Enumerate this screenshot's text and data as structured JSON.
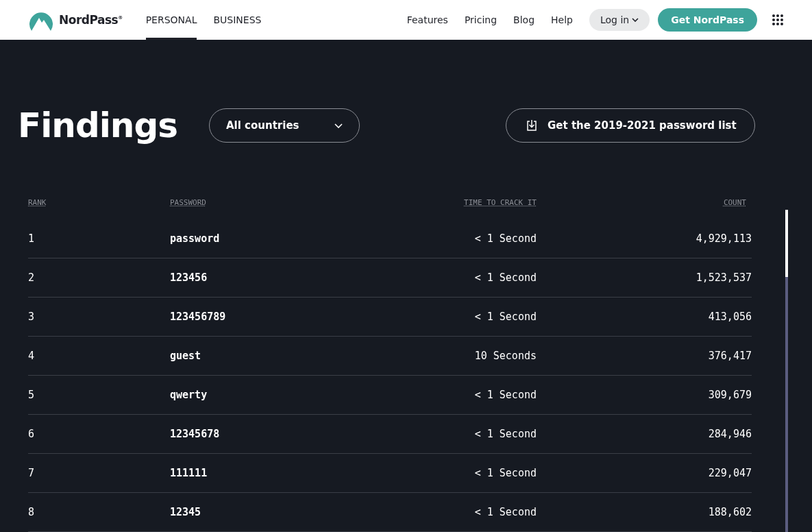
{
  "nav": {
    "brand": "NordPass",
    "brand_mark": "®",
    "tabs": [
      {
        "label": "PERSONAL",
        "selected": true
      },
      {
        "label": "BUSINESS",
        "selected": false
      }
    ],
    "links": [
      "Features",
      "Pricing",
      "Blog",
      "Help"
    ],
    "login": "Log in",
    "cta": "Get NordPass"
  },
  "heading": "Findings",
  "country_select": {
    "value": "All countries"
  },
  "download": "Get the 2019-2021 password list",
  "table": {
    "columns": [
      "RANK",
      "PASSWORD",
      "TIME TO CRACK IT",
      "COUNT"
    ],
    "rows": [
      [
        "1",
        "password",
        "< 1 Second",
        "4,929,113"
      ],
      [
        "2",
        "123456",
        "< 1 Second",
        "1,523,537"
      ],
      [
        "3",
        "123456789",
        "< 1 Second",
        "413,056"
      ],
      [
        "4",
        "guest",
        "10 Seconds",
        "376,417"
      ],
      [
        "5",
        "qwerty",
        "< 1 Second",
        "309,679"
      ],
      [
        "6",
        "12345678",
        "< 1 Second",
        "284,946"
      ],
      [
        "7",
        "111111",
        "< 1 Second",
        "229,047"
      ],
      [
        "8",
        "12345",
        "< 1 Second",
        "188,602"
      ]
    ]
  }
}
